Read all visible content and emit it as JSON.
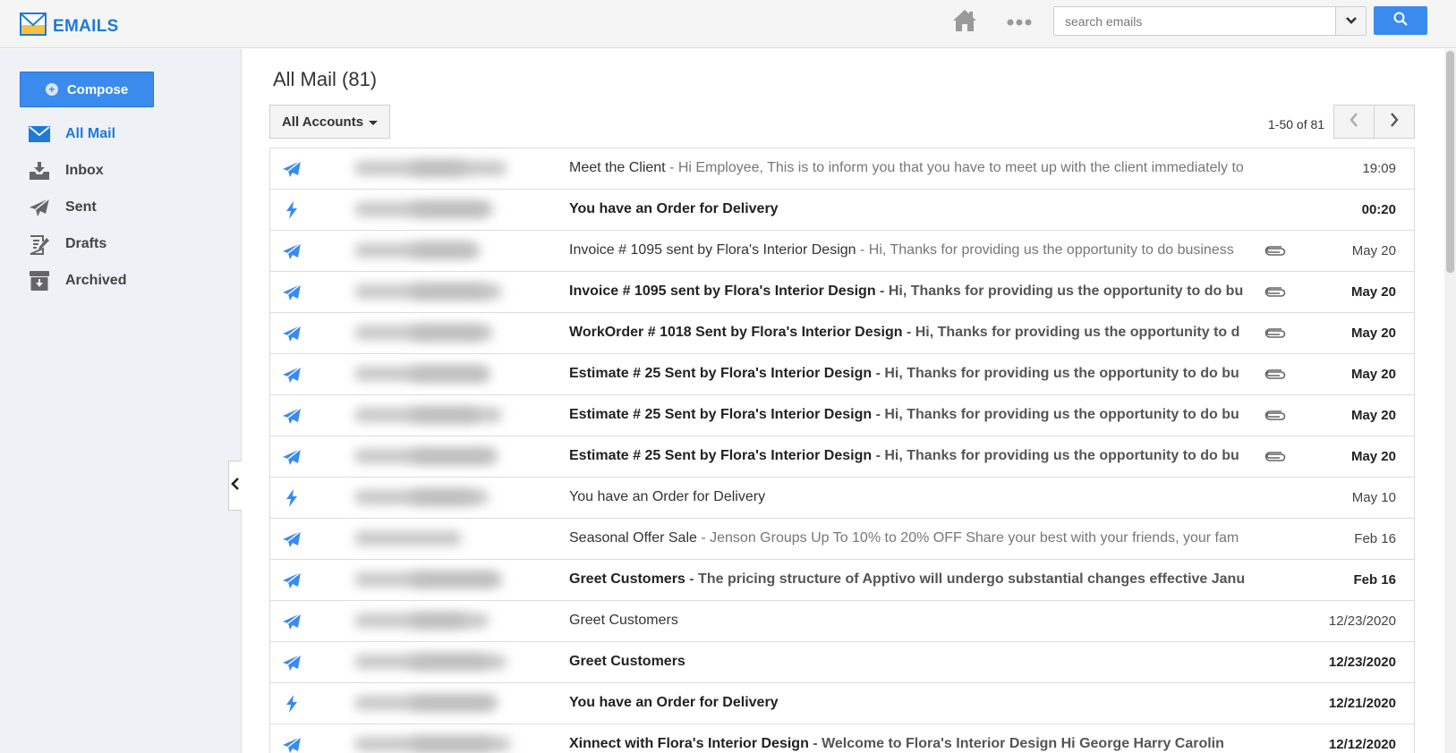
{
  "app": {
    "title": "EMAILS",
    "accent_color": "#3b8bee",
    "brand_color": "#1e7ad8",
    "logo_icon": "envelope-icon"
  },
  "header": {
    "home_icon": "home-icon",
    "more_icon": "more-dots-icon",
    "search": {
      "placeholder": "search emails",
      "value": "",
      "dropdown_icon": "chevron-down-icon",
      "button_icon": "search-icon"
    }
  },
  "sidebar": {
    "compose_label": "Compose",
    "items": [
      {
        "label": "All Mail",
        "icon": "mail-icon",
        "active": true
      },
      {
        "label": "Inbox",
        "icon": "inbox-icon",
        "active": false
      },
      {
        "label": "Sent",
        "icon": "send-icon",
        "active": false
      },
      {
        "label": "Drafts",
        "icon": "drafts-icon",
        "active": false
      },
      {
        "label": "Archived",
        "icon": "archive-icon",
        "active": false
      }
    ],
    "collapse_icon": "chevron-left-icon"
  },
  "main": {
    "title": "All Mail (81)",
    "account_filter": "All Accounts",
    "pager": {
      "text": "1-50 of 81",
      "prev_icon": "chevron-left-icon",
      "next_icon": "chevron-right-icon"
    },
    "emails": [
      {
        "type": "sent",
        "unread": false,
        "subject": "Meet the Client",
        "snippet": " - Hi Employee, This is to inform you that you have to meet up with the client immediately to",
        "attachment": false,
        "date": "19:09"
      },
      {
        "type": "order",
        "unread": true,
        "subject": "You have an Order for Delivery",
        "snippet": "",
        "attachment": false,
        "date": "00:20"
      },
      {
        "type": "sent",
        "unread": false,
        "subject": "Invoice # 1095 sent by Flora's Interior Design",
        "snippet": " - Hi,  Thanks for providing us the opportunity to do business",
        "attachment": true,
        "date": "May 20"
      },
      {
        "type": "sent",
        "unread": true,
        "subject": "Invoice # 1095 sent by Flora's Interior Design",
        "snippet": " - Hi,  Thanks for providing us the opportunity to do bu",
        "attachment": true,
        "date": "May 20"
      },
      {
        "type": "sent",
        "unread": true,
        "subject": "WorkOrder # 1018 Sent by Flora's Interior Design",
        "snippet": " - Hi, Thanks for providing us the opportunity to d",
        "attachment": true,
        "date": "May 20"
      },
      {
        "type": "sent",
        "unread": true,
        "subject": "Estimate # 25 Sent by Flora's Interior Design",
        "snippet": " - Hi,  Thanks for providing us the opportunity to do bu",
        "attachment": true,
        "date": "May 20"
      },
      {
        "type": "sent",
        "unread": true,
        "subject": "Estimate # 25 Sent by Flora's Interior Design",
        "snippet": " - Hi,  Thanks for providing us the opportunity to do bu",
        "attachment": true,
        "date": "May 20"
      },
      {
        "type": "sent",
        "unread": true,
        "subject": "Estimate # 25 Sent by Flora's Interior Design",
        "snippet": " - Hi,  Thanks for providing us the opportunity to do bu",
        "attachment": true,
        "date": "May 20"
      },
      {
        "type": "order",
        "unread": false,
        "subject": "You have an Order for Delivery",
        "snippet": "",
        "attachment": false,
        "date": "May 10"
      },
      {
        "type": "sent",
        "unread": false,
        "subject": "Seasonal Offer Sale",
        "snippet": " - Jenson Groups Up To 10% to 20% OFF Share your best with your friends, your fam",
        "attachment": false,
        "date": "Feb 16"
      },
      {
        "type": "sent",
        "unread": true,
        "subject": "Greet Customers",
        "snippet": " - The pricing structure of Apptivo will undergo substantial changes effective Janu",
        "attachment": false,
        "date": "Feb 16"
      },
      {
        "type": "sent",
        "unread": false,
        "subject": "Greet Customers",
        "snippet": "",
        "attachment": false,
        "date": "12/23/2020"
      },
      {
        "type": "sent",
        "unread": true,
        "subject": "Greet Customers",
        "snippet": "",
        "attachment": false,
        "date": "12/23/2020"
      },
      {
        "type": "order",
        "unread": true,
        "subject": "You have an Order for Delivery",
        "snippet": "",
        "attachment": false,
        "date": "12/21/2020"
      },
      {
        "type": "sent",
        "unread": true,
        "subject": "Xinnect with Flora's Interior Design",
        "snippet": " - Welcome to Flora's Interior Design  Hi George Harry Carolin",
        "attachment": false,
        "date": "12/12/2020"
      }
    ]
  }
}
